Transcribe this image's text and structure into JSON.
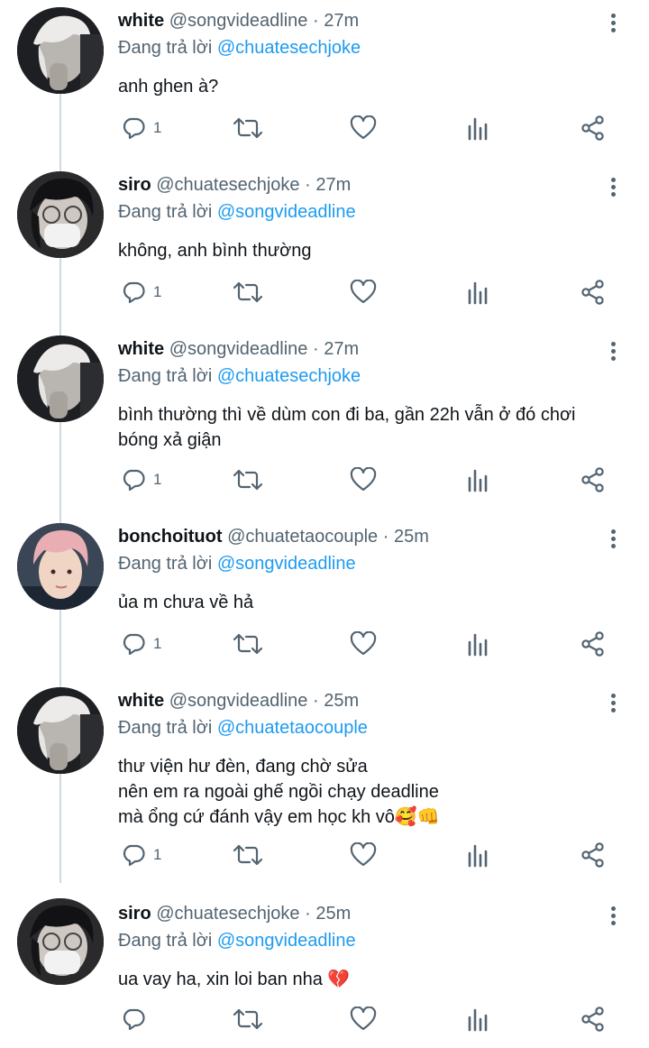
{
  "colors": {
    "link": "#1d9bf0",
    "muted": "#536471",
    "text": "#0f1419",
    "line": "#cfd9de"
  },
  "reply_prefix": "Đang trả lời",
  "tweets": [
    {
      "name": "white",
      "handle": "@songvideadline",
      "time": "27m",
      "replying_to": "@chuatesechjoke",
      "lines": [
        "anh ghen à?"
      ],
      "reply_count": "1",
      "avatar": "white-hair"
    },
    {
      "name": "siro",
      "handle": "@chuatesechjoke",
      "time": "27m",
      "replying_to": "@songvideadline",
      "lines": [
        "không, anh bình thường"
      ],
      "reply_count": "1",
      "avatar": "masked-dark"
    },
    {
      "name": "white",
      "handle": "@songvideadline",
      "time": "27m",
      "replying_to": "@chuatesechjoke",
      "lines": [
        "bình thường thì về dùm con đi ba, gần 22h vẫn ở đó chơi",
        "bóng xả giận"
      ],
      "reply_count": "1",
      "avatar": "white-hair"
    },
    {
      "name": "bonchoituot",
      "handle": "@chuatetaocouple",
      "time": "25m",
      "replying_to": "@songvideadline",
      "lines": [
        "ủa m chưa về hả"
      ],
      "reply_count": "1",
      "avatar": "pink-hair"
    },
    {
      "name": "white",
      "handle": "@songvideadline",
      "time": "25m",
      "replying_to": "@chuatetaocouple",
      "lines": [
        "thư viện hư đèn, đang chờ sửa",
        "nên em ra ngoài ghế ngồi chạy deadline",
        "mà ổng cứ đánh vậy em học kh vô🥰👊"
      ],
      "reply_count": "1",
      "avatar": "white-hair"
    },
    {
      "name": "siro",
      "handle": "@chuatesechjoke",
      "time": "25m",
      "replying_to": "@songvideadline",
      "lines": [
        "ua vay ha, xin loi ban nha 💔"
      ],
      "reply_count": "",
      "avatar": "masked-dark"
    }
  ]
}
